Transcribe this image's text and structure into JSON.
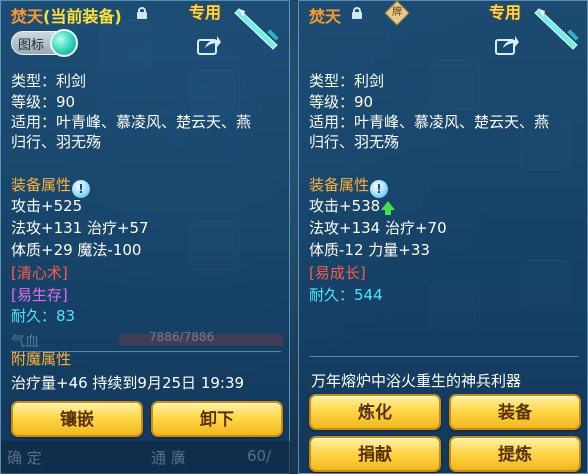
{
  "left_panel": {
    "name": "焚天",
    "current_tag": "(当前装备)",
    "exclusive_label": "专用",
    "toggle_label": "图标",
    "type_line": "类型：利剑",
    "level_line": "等级：90",
    "fit_line1": "适用：叶青峰、慕凌风、楚云天、燕",
    "fit_line2": "归行、羽无殇",
    "attr_title": "装备属性",
    "attr_line1": "攻击+525",
    "attr_line2": "法攻+131 治疗+57",
    "attr_line3": "体质+29 魔法-100",
    "special1": "[清心术]",
    "special2": "[易生存]",
    "durability_label": "耐久：",
    "durability_value": "83",
    "hp_label": "气血",
    "hp_value": "7886/7886",
    "enchant_title": "附魔属性",
    "enchant_line": "治疗量+46 持续到9月25日 19:39",
    "btn_inlay": "镶嵌",
    "btn_unequip": "卸下"
  },
  "right_panel": {
    "name": "焚天",
    "bind_badge": "牌",
    "exclusive_label": "专用",
    "type_line": "类型：利剑",
    "level_line": "等级：90",
    "fit_line1": "适用：叶青峰、慕凌风、楚云天、燕",
    "fit_line2": "归行、羽无殇",
    "attr_title": "装备属性",
    "attr_line1": "攻击+538",
    "attr_line2": "法攻+134 治疗+70",
    "attr_line3": "体质-12 力量+33",
    "special1": "[易成长]",
    "durability_label": "耐久：",
    "durability_value": "544",
    "description": "万年熔炉中浴火重生的神兵利器",
    "btn_refine": "炼化",
    "btn_equip": "装备",
    "btn_donate": "捐献",
    "btn_extract": "提炼"
  },
  "background": {
    "bottom_left": "确 定",
    "bottom_mid": "通 廣",
    "bottom_right": "60/"
  },
  "colors": {
    "name_orange": "#ff9a2e",
    "section_orange": "#ffb13a",
    "durability_cyan": "#4fe4ff",
    "special_red": "#ff5a4a",
    "special_purple": "#e36cf0",
    "button_gold": "#ffd84a",
    "arrow_green": "#45e04a"
  },
  "icons": [
    "lock-icon",
    "sword-icon",
    "share-icon",
    "info-icon",
    "up-arrow-icon",
    "bind-badge-icon"
  ]
}
